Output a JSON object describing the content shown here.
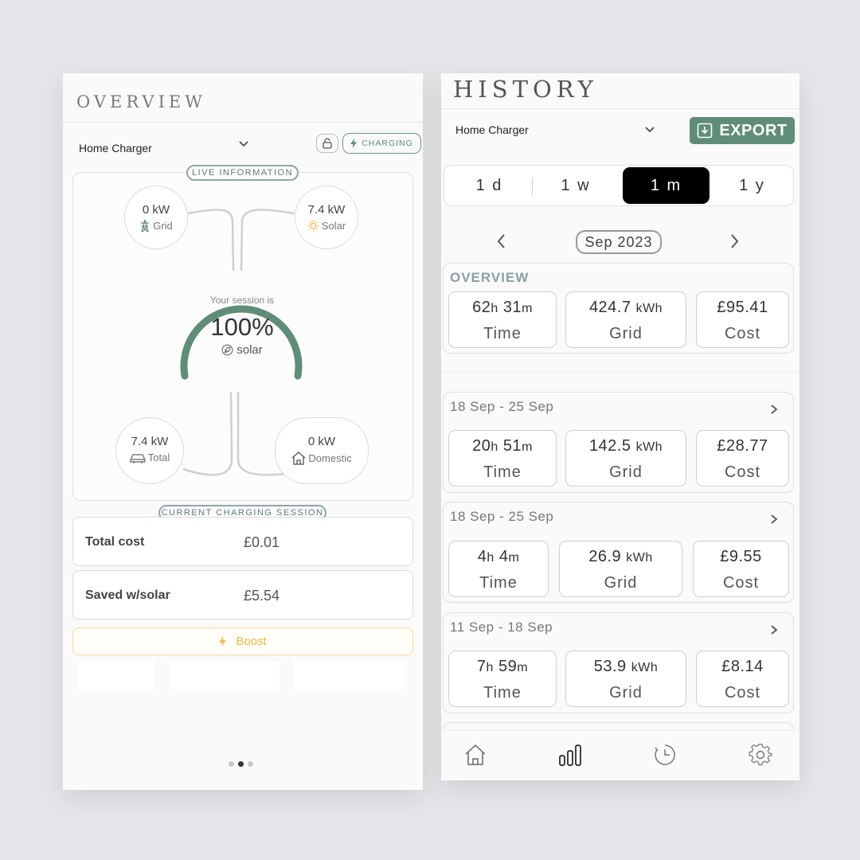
{
  "overview": {
    "title": "OVERVIEW",
    "device": "Home Charger",
    "charging_label": "CHARGING",
    "live_label": "LIVE INFORMATION",
    "grid": {
      "value": "0 kW",
      "label": "Grid"
    },
    "solar": {
      "value": "7.4 kW",
      "label": "Solar"
    },
    "total": {
      "value": "7.4 kW",
      "label": "Total"
    },
    "domestic": {
      "value": "0 kW",
      "label": "Domestic"
    },
    "gauge": {
      "caption": "Your session is",
      "percent": "100%",
      "source": "solar",
      "fill_fraction": 1.0
    },
    "session_label": "CURRENT CHARGING SESSION",
    "total_cost": {
      "label": "Total cost",
      "value": "£0.01"
    },
    "saved": {
      "label": "Saved w/solar",
      "value": "£5.54"
    },
    "boost_label": "Boost",
    "page_indicator": {
      "count": 3,
      "active": 1
    }
  },
  "history": {
    "title": "HISTORY",
    "device": "Home Charger",
    "export_label": "EXPORT",
    "ranges": [
      "1 d",
      "1 w",
      "1 m",
      "1 y"
    ],
    "selected_range": "1 m",
    "month": "Sep 2023",
    "overview_card": {
      "heading": "OVERVIEW",
      "time": {
        "h": "62",
        "m": "31",
        "label": "Time"
      },
      "grid": {
        "value": "424.7",
        "unit": "kWh",
        "label": "Grid"
      },
      "cost": {
        "value": "£95.41",
        "label": "Cost"
      }
    },
    "weeks": [
      {
        "range": "18 Sep - 25 Sep",
        "h": "20",
        "m": "51",
        "time_label": "Time",
        "grid": "142.5",
        "unit": "kWh",
        "grid_label": "Grid",
        "cost": "£28.77",
        "cost_label": "Cost"
      },
      {
        "range": "18 Sep - 25 Sep",
        "h": "4",
        "m": "4",
        "time_label": "Time",
        "grid": "26.9",
        "unit": "kWh",
        "grid_label": "Grid",
        "cost": "£9.55",
        "cost_label": "Cost"
      },
      {
        "range": "11 Sep - 18 Sep",
        "h": "7",
        "m": "59",
        "time_label": "Time",
        "grid": "53.9",
        "unit": "kWh",
        "grid_label": "Grid",
        "cost": "£8.14",
        "cost_label": "Cost"
      }
    ],
    "units": {
      "hours": "h",
      "minutes": "m"
    },
    "nav": [
      "home-icon",
      "bar-chart-icon",
      "history-clock-icon",
      "settings-gear-icon"
    ],
    "nav_active": "bar-chart-icon"
  },
  "colors": {
    "accent_green": "#5f8d77",
    "boost_orange": "#f2b94a",
    "selected_segment": "#000000",
    "solar_sun": "#f2b94a"
  }
}
